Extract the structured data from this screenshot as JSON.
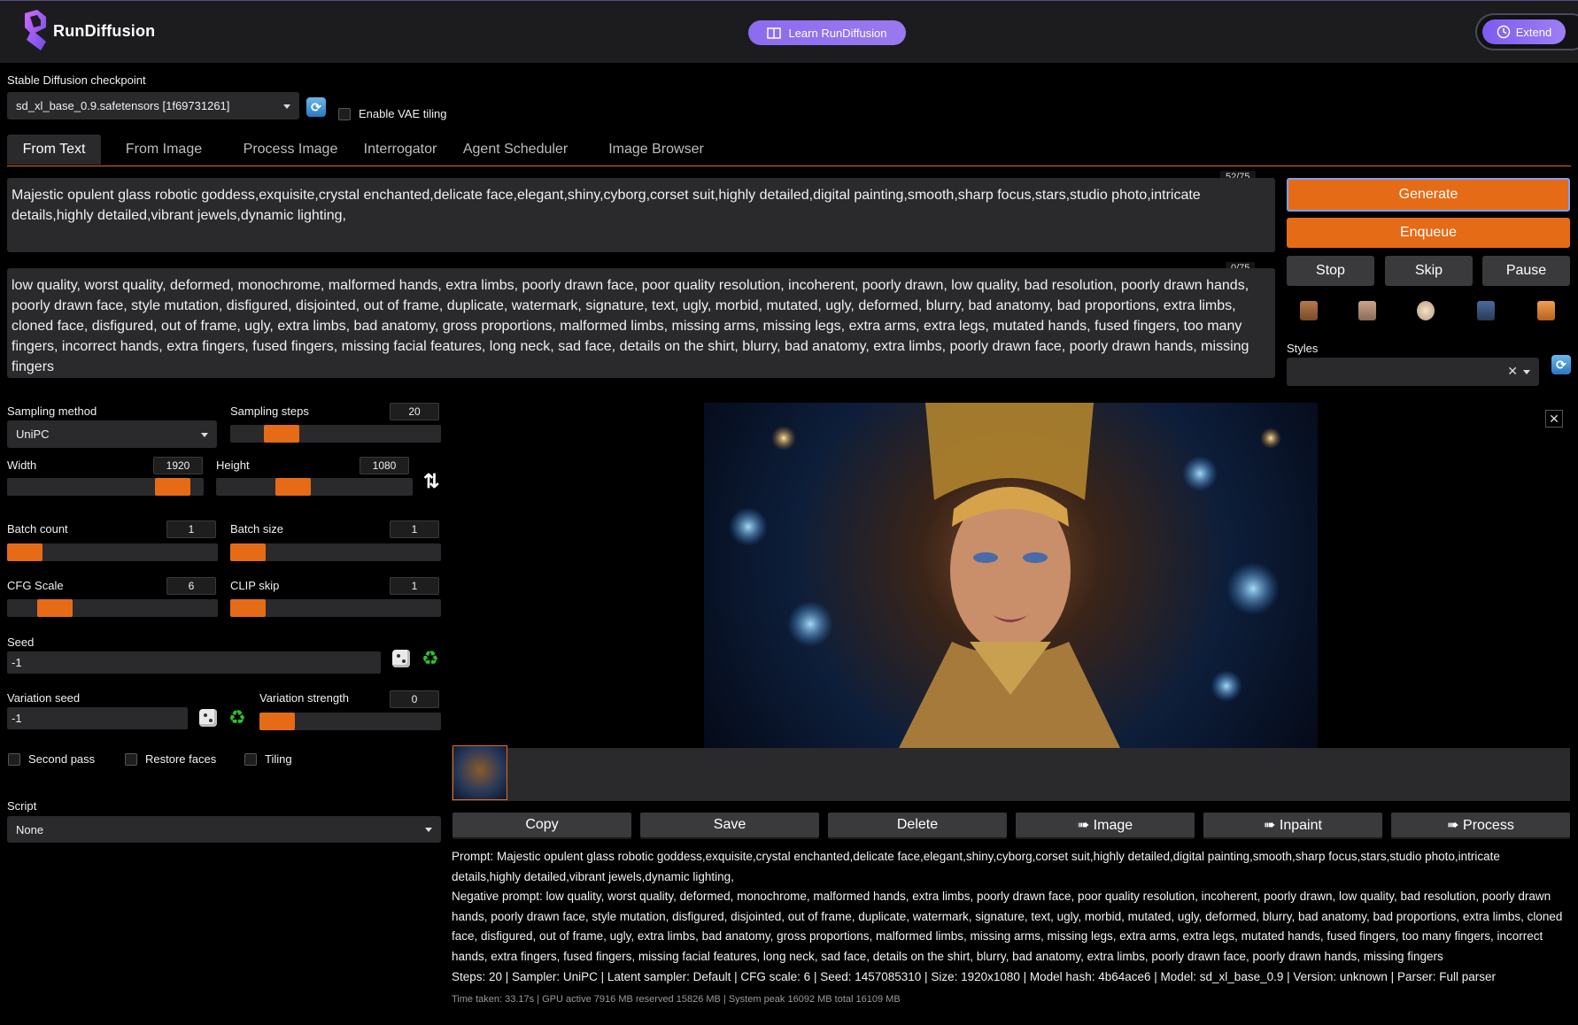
{
  "header": {
    "brand": "RunDiffusion",
    "learn_label": "Learn RunDiffusion",
    "extend_label": "Extend"
  },
  "checkpoint": {
    "label": "Stable Diffusion checkpoint",
    "value": "sd_xl_base_0.9.safetensors [1f69731261]",
    "vae_label": "Enable VAE tiling"
  },
  "tabs": [
    "From Text",
    "From Image",
    "Process Image",
    "Interrogator",
    "Agent Scheduler",
    "Image Browser"
  ],
  "prompt": {
    "text": "Majestic opulent glass robotic goddess,exquisite,crystal enchanted,delicate face,elegant,shiny,cyborg,corset suit,highly detailed,digital painting,smooth,sharp focus,stars,studio photo,intricate details,highly detailed,vibrant jewels,dynamic lighting,",
    "counter": "52/75"
  },
  "negative": {
    "text": "low quality, worst quality, deformed, monochrome, malformed hands, extra limbs, poorly drawn face, poor quality resolution, incoherent, poorly drawn, low quality, bad resolution, poorly drawn hands, poorly drawn face, style mutation, disfigured, disjointed, out of frame, duplicate, watermark, signature, text, ugly, morbid, mutated, ugly, deformed, blurry, bad anatomy, bad proportions, extra limbs, cloned face, disfigured, out of frame, ugly, extra limbs, bad anatomy, gross proportions, malformed limbs, missing arms, missing legs, extra arms, extra legs, mutated hands, fused fingers, too many fingers, incorrect hands, extra fingers, fused fingers, missing facial features, long neck, sad face, details on the shirt, blurry, bad anatomy, extra limbs, poorly drawn face, poorly drawn hands, missing fingers",
    "counter": "0/75"
  },
  "actions": {
    "generate": "Generate",
    "enqueue": "Enqueue",
    "stop": "Stop",
    "skip": "Skip",
    "pause": "Pause",
    "styles_label": "Styles"
  },
  "params": {
    "sampling_method_label": "Sampling method",
    "sampling_method": "UniPC",
    "sampling_steps_label": "Sampling steps",
    "sampling_steps": "20",
    "width_label": "Width",
    "width": "1920",
    "height_label": "Height",
    "height": "1080",
    "batch_count_label": "Batch count",
    "batch_count": "1",
    "batch_size_label": "Batch size",
    "batch_size": "1",
    "cfg_label": "CFG Scale",
    "cfg": "6",
    "clip_label": "CLIP skip",
    "clip": "1",
    "seed_label": "Seed",
    "seed": "-1",
    "variation_seed_label": "Variation seed",
    "variation_seed": "-1",
    "variation_strength_label": "Variation strength",
    "variation_strength": "0",
    "second_pass": "Second pass",
    "restore_faces": "Restore faces",
    "tiling": "Tiling",
    "script_label": "Script",
    "script": "None"
  },
  "output_buttons": [
    "Copy",
    "Save",
    "Delete",
    "➠ Image",
    "➠ Inpaint",
    "➠ Process"
  ],
  "info": {
    "prompt_line": "Prompt: Majestic opulent glass robotic goddess,exquisite,crystal enchanted,delicate face,elegant,shiny,cyborg,corset suit,highly detailed,digital painting,smooth,sharp focus,stars,studio photo,intricate details,highly detailed,vibrant jewels,dynamic lighting,",
    "negative_line": "Negative prompt: low quality, worst quality, deformed, monochrome, malformed hands, extra limbs, poorly drawn face, poor quality resolution, incoherent, poorly drawn, low quality, bad resolution, poorly drawn hands, poorly drawn face, style mutation, disfigured, disjointed, out of frame, duplicate, watermark, signature, text, ugly, morbid, mutated, ugly, deformed, blurry, bad anatomy, bad proportions, extra limbs, cloned face, disfigured, out of frame, ugly, extra limbs, bad anatomy, gross proportions, malformed limbs, missing arms, missing legs, extra arms, extra legs, mutated hands, fused fingers, too many fingers, incorrect hands, extra fingers, fused fingers, missing facial features, long neck, sad face, details on the shirt, blurry, bad anatomy, extra limbs, poorly drawn face, poorly drawn hands, missing fingers",
    "params_line": "Steps: 20 | Sampler: UniPC | Latent sampler: Default | CFG scale: 6 | Seed: 1457085310 | Size: 1920x1080 | Model hash: 4b64ace6 | Model: sd_xl_base_0.9 | Version: unknown | Parser: Full parser",
    "timing": "Time taken: 33.17s | GPU active 7916 MB reserved 15826 MB | System peak 16092 MB total 16109 MB"
  },
  "colors": {
    "accent": "#e56b17",
    "brand_purple": "#8b6cf0",
    "panel": "#2a2a2c",
    "background": "#000000"
  }
}
